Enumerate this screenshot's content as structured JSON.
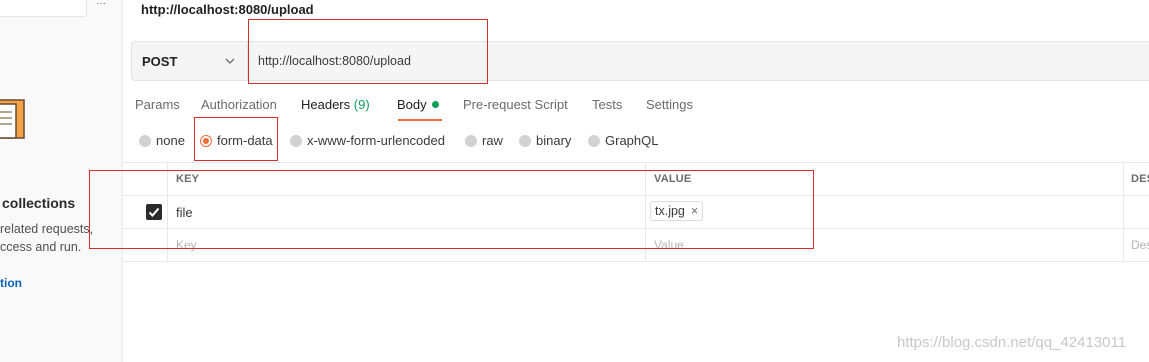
{
  "sidebar": {
    "more_icon": "···",
    "collections_title": "collections",
    "desc_line1": "related requests,",
    "desc_line2": "ccess and run.",
    "link": "tion"
  },
  "request": {
    "tab_title": "http://localhost:8080/upload",
    "method": "POST",
    "url": "http://localhost:8080/upload"
  },
  "tabs": [
    {
      "label": "Params"
    },
    {
      "label": "Authorization"
    },
    {
      "label": "Headers",
      "count": "(9)"
    },
    {
      "label": "Body"
    },
    {
      "label": "Pre-request Script"
    },
    {
      "label": "Tests"
    },
    {
      "label": "Settings"
    }
  ],
  "body_types": [
    {
      "label": "none",
      "selected": false
    },
    {
      "label": "form-data",
      "selected": true
    },
    {
      "label": "x-www-form-urlencoded",
      "selected": false
    },
    {
      "label": "raw",
      "selected": false
    },
    {
      "label": "binary",
      "selected": false
    },
    {
      "label": "GraphQL",
      "selected": false
    }
  ],
  "table": {
    "headers": {
      "key": "KEY",
      "value": "VALUE",
      "desc": "DES"
    },
    "rows": [
      {
        "checked": true,
        "key": "file",
        "value_chip": "tx.jpg",
        "remove_icon": "×"
      }
    ],
    "placeholders": {
      "key": "Key",
      "value": "Value",
      "desc": "Des"
    }
  },
  "watermark": "https://blog.csdn.net/qq_42413011",
  "colors": {
    "accent": "#f26b3a",
    "success": "#0f9d58",
    "annotation": "#d32f2f",
    "link": "#0b63b8"
  }
}
